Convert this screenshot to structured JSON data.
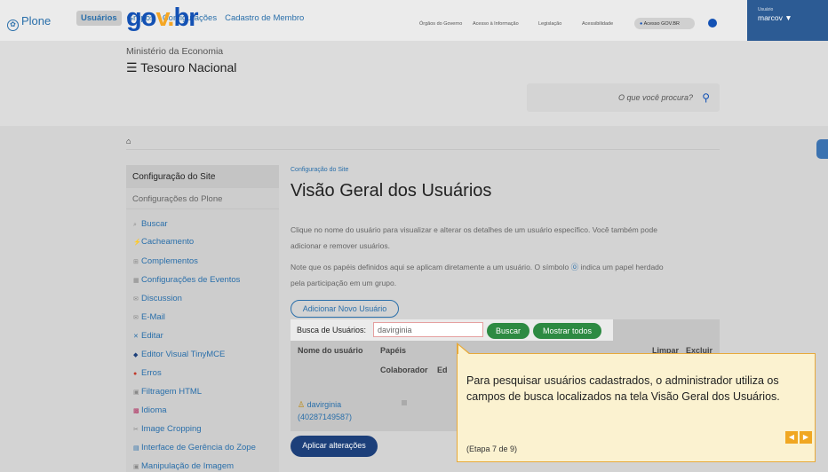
{
  "toolbar": {
    "logo": "Plone",
    "nav": [
      "Usuários",
      "Grupos",
      "Configurações",
      "Cadastro de Membro"
    ],
    "user_label": "Usuário",
    "user_name": "marcov ▼"
  },
  "header": {
    "logo": {
      "g": "go",
      "v": "v",
      "dot": ".",
      "br": "br"
    },
    "ministry": "Ministério da Economia",
    "org": "☰ Tesouro Nacional",
    "links": [
      "Órgãos do Governo",
      "Acesso à Informação",
      "Legislação",
      "Acessibilidade"
    ],
    "gov_access": "Acesso GOV.BR",
    "search_placeholder": "O que você procura?"
  },
  "sidebar": {
    "header": "Configuração do Site",
    "subheader": "Configurações do Plone",
    "items": [
      "Buscar",
      "Cacheamento",
      "Complementos",
      "Configurações de Eventos",
      "Discussion",
      "E-Mail",
      "Editar",
      "Editor Visual TinyMCE",
      "Erros",
      "Filtragem HTML",
      "Idioma",
      "Image Cropping",
      "Interface de Gerência do Zope",
      "Manipulação de Imagem"
    ]
  },
  "main": {
    "breadcrumb": "Configuração do Site",
    "title": "Visão Geral dos Usuários",
    "p1a": "Clique no nome do usuário para visualizar e alterar os detalhes de um usuário específico. Você também pode",
    "p1b": "adicionar e remover usuários.",
    "p2a": "Note que os papéis definidos aqui se aplicam diretamente a um usuário. O símbolo",
    "p2sym": "⓪",
    "p2b": "indica um papel herdado",
    "p2c": "pela participação em um grupo.",
    "add_button": "Adicionar Novo Usuário",
    "search_label": "Busca de Usuários:",
    "search_value": "davirginia",
    "search_button": "Buscar",
    "show_all_button": "Mostrar todos",
    "col_name": "Nome do usuário",
    "col_roles": "Papéis",
    "col_clear": "Limpar",
    "col_delete": "Excluir",
    "role_collab": "Colaborador",
    "role_ed": "Ed",
    "user_name": "davirginia",
    "user_id": "(40287149587)",
    "apply_button": "Aplicar alterações"
  },
  "tooltip": {
    "text": "Para pesquisar usuários cadastrados, o administrador utiliza os campos de busca localizados na tela Visão Geral dos Usuários.",
    "step": "(Etapa 7 de 9)",
    "prev": "◀",
    "next": "▶"
  },
  "colors": {
    "accent": "#1351b4",
    "govbr_yellow": "#f5a623",
    "green": "#2d8a42",
    "tooltip_border": "#e7a93a"
  }
}
